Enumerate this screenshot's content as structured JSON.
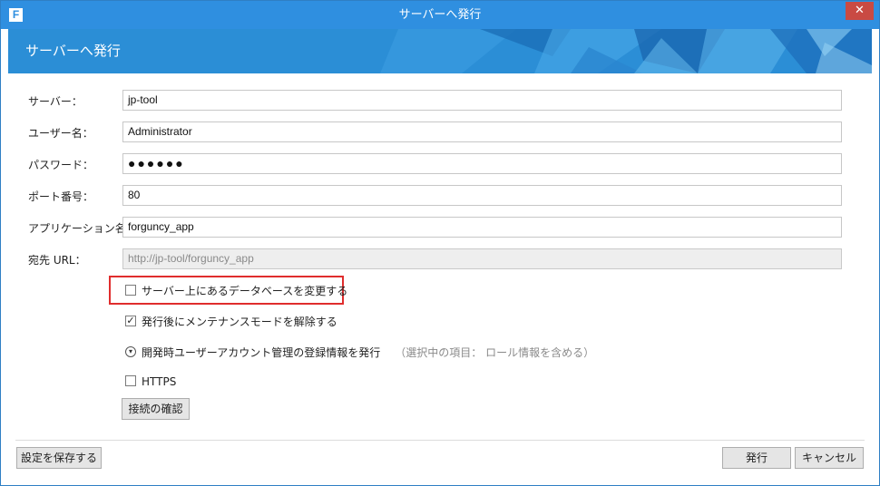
{
  "window": {
    "title": "サーバーへ発行",
    "app_icon": "F",
    "close_glyph": "✕"
  },
  "banner": {
    "title": "サーバーへ発行"
  },
  "form": {
    "server": {
      "label": "サーバー：",
      "value": "jp-tool"
    },
    "user": {
      "label": "ユーザー名：",
      "value": "Administrator"
    },
    "password": {
      "label": "パスワード：",
      "value": "●●●●●●"
    },
    "port": {
      "label": "ポート番号：",
      "value": "80"
    },
    "app_name": {
      "label": "アプリケーション名：",
      "value": "forguncy_app"
    },
    "dest_url": {
      "label": "宛先 URL：",
      "value": "http://jp-tool/forguncy_app"
    }
  },
  "options": {
    "change_db": {
      "label": "サーバー上にあるデータベースを変更する",
      "checked": false
    },
    "release_maintenance": {
      "label": "発行後にメンテナンスモードを解除する",
      "checked": true
    },
    "publish_accounts": {
      "label": "開発時ユーザーアカウント管理の登録情報を発行",
      "note": "（選択中の項目： ロール情報を含める）",
      "icon": "chevron-down-circle-icon"
    },
    "https": {
      "label": "HTTPS",
      "checked": false
    }
  },
  "buttons": {
    "test_connection": "接続の確認",
    "save_settings": "設定を保存する",
    "publish": "発行",
    "cancel": "キャンセル"
  },
  "colors": {
    "titlebar": "#2f8fe0",
    "banner": "#2b8ed6",
    "close": "#c94a43",
    "highlight": "#e02d2d"
  }
}
